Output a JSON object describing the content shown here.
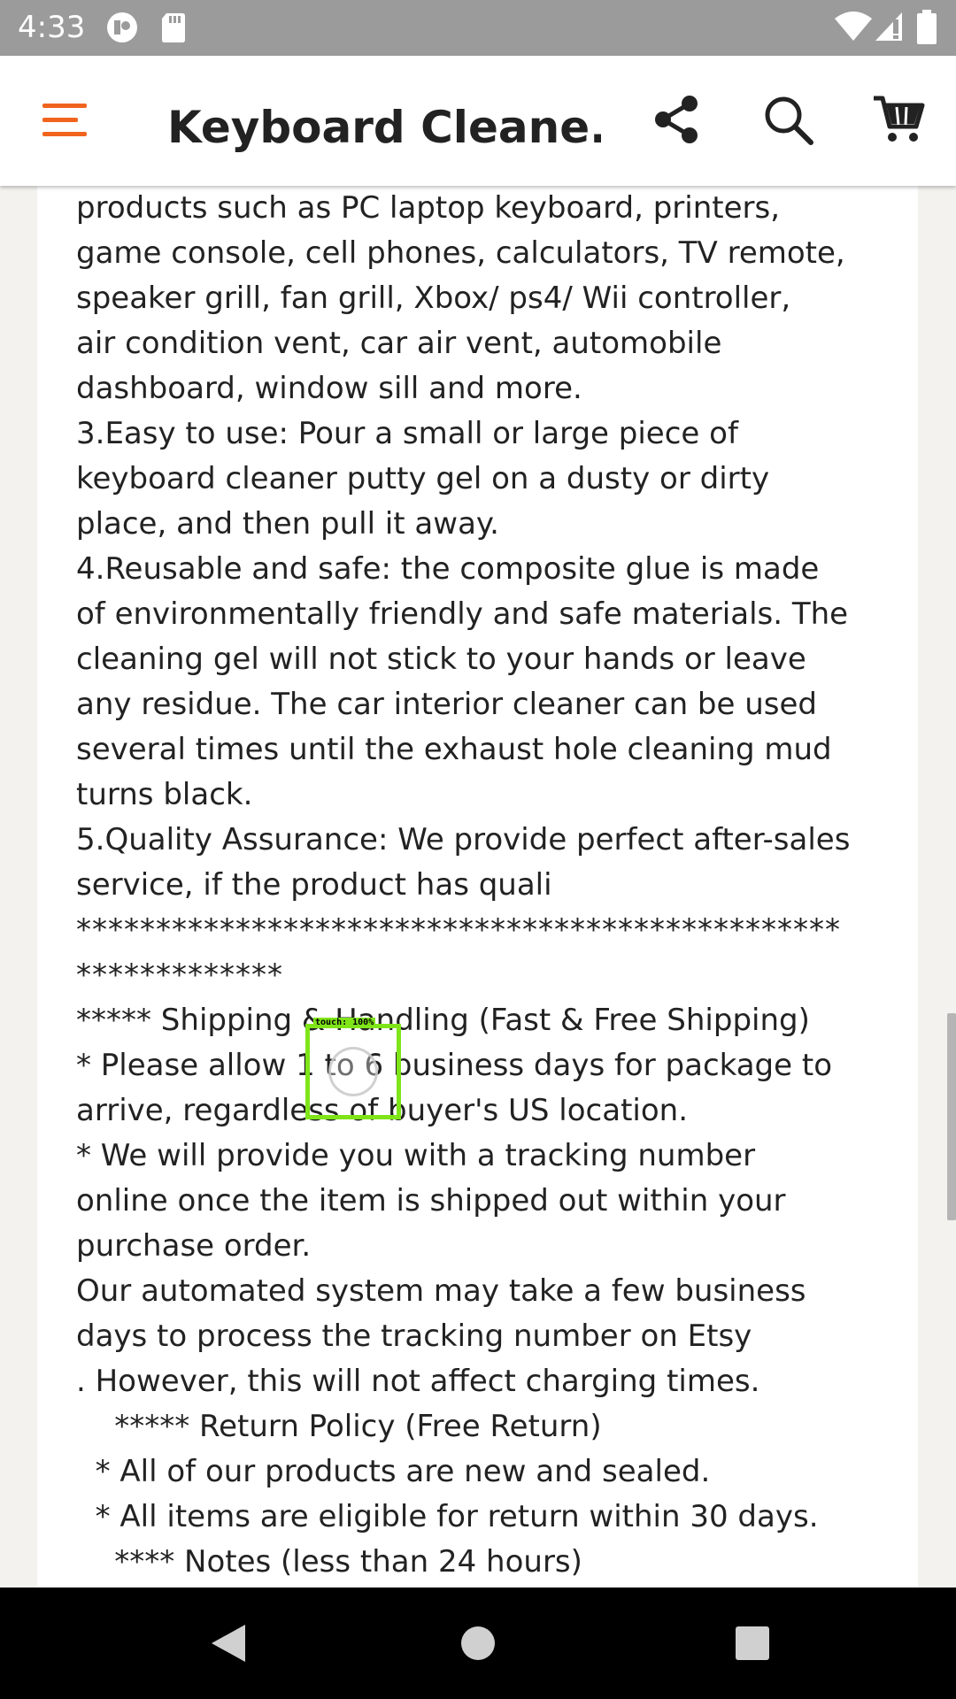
{
  "status_bar": {
    "time": "4:33",
    "icons": [
      "app-notification-icon",
      "sd-card-icon",
      "wifi-icon",
      "cell-signal-icon",
      "battery-icon"
    ]
  },
  "app_bar": {
    "title": "Keyboard Cleane...",
    "menu_icon": "hamburger-menu-icon",
    "share_icon": "share-icon",
    "search_icon": "search-icon",
    "cart_icon": "cart-icon",
    "accent_color": "#f1641e"
  },
  "description": {
    "lines": [
      "products such as PC laptop keyboard, printers,",
      "game console, cell phones, calculators, TV remote,",
      "speaker grill, fan grill, Xbox/ ps4/ Wii controller,",
      "air condition vent, car air vent, automobile",
      "dashboard, window sill and more.",
      "3.Easy to use: Pour a small or large piece of",
      "keyboard cleaner putty gel on a dusty or dirty",
      "place, and then pull it away.",
      "4.Reusable and safe: the composite glue is made",
      "of environmentally friendly and safe materials. The",
      "cleaning gel will not stick to your hands or leave",
      "any residue. The car interior cleaner can be used",
      "several times until the exhaust hole cleaning mud",
      "turns black.",
      "5.Quality Assurance: We provide perfect after-sales",
      "service, if the product has quali",
      "************************************************",
      "*************",
      "***** Shipping & Handling (Fast & Free Shipping)",
      "* Please allow 1 to 6 business days for package to",
      "arrive, regardless of buyer's US location.",
      "* We will provide you with a tracking number",
      "online once the item is shipped out within your",
      "purchase order.",
      "Our automated system may take a few business",
      "days to process the tracking number on Etsy",
      ". However, this will not affect charging times.",
      "    ***** Return Policy (Free Return)",
      "  * All of our products are new and sealed.",
      "  * All items are eligible for return within 30 days.",
      "    **** Notes (less than 24 hours)"
    ]
  },
  "touch_indicator": {
    "label": "touch: 100%"
  },
  "nav_bar": {
    "back_icon": "back-triangle-icon",
    "home_icon": "home-circle-icon",
    "recents_icon": "recents-square-icon"
  }
}
